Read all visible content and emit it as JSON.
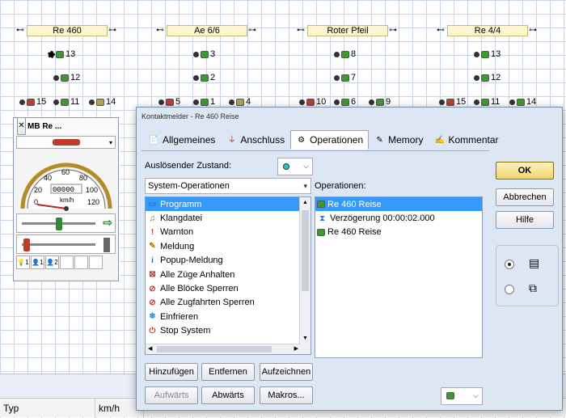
{
  "track": {
    "blocks": [
      {
        "label": "Re 460"
      },
      {
        "label": "Ae 6/6"
      },
      {
        "label": "Roter Pfeil"
      },
      {
        "label": "Re 4/4"
      }
    ],
    "signals": {
      "c1": [
        "13",
        "12",
        "15",
        "11",
        "14"
      ],
      "c2": [
        "3",
        "2",
        "5",
        "1",
        "4"
      ],
      "c3": [
        "8",
        "7",
        "10",
        "6",
        "9"
      ],
      "c4": [
        "13",
        "12",
        "15",
        "11",
        "14"
      ]
    }
  },
  "statusbar": {
    "col1": "Typ",
    "col2": "km/h"
  },
  "loco_panel": {
    "title": "MB Re ...",
    "speed_unit": "km/h",
    "odometer": "00000",
    "gauge_ticks": [
      "0",
      "20",
      "40",
      "60",
      "80",
      "100",
      "120"
    ],
    "speed_value": 0,
    "fn_labels": [
      "1",
      "1",
      "2"
    ]
  },
  "dialog": {
    "title": "Kontaktmelder - Re 460 Reise",
    "tabs": [
      {
        "label": "Allgemeines",
        "icon": "general-icon"
      },
      {
        "label": "Anschluss",
        "icon": "plug-icon"
      },
      {
        "label": "Operationen",
        "icon": "operations-icon"
      },
      {
        "label": "Memory",
        "icon": "memory-icon"
      },
      {
        "label": "Kommentar",
        "icon": "comment-icon"
      }
    ],
    "trigger_label": "Auslösender Zustand:",
    "category_value": "System-Operationen",
    "operations_label": "Operationen:",
    "available_ops": [
      {
        "label": "Programm",
        "icon": "program-icon",
        "color": "#3b6fd1"
      },
      {
        "label": "Klangdatei",
        "icon": "sound-icon",
        "color": "#4a7c2f"
      },
      {
        "label": "Warnton",
        "icon": "warning-icon",
        "color": "#c0392b"
      },
      {
        "label": "Meldung",
        "icon": "message-icon",
        "color": "#b8860b"
      },
      {
        "label": "Popup-Meldung",
        "icon": "info-icon",
        "color": "#2b5fb5"
      },
      {
        "label": "Alle Züge Anhalten",
        "icon": "stop-trains-icon",
        "color": "#c0392b"
      },
      {
        "label": "Alle Blöcke Sperren",
        "icon": "lock-blocks-icon",
        "color": "#c0392b"
      },
      {
        "label": "Alle Zugfahrten Sperren",
        "icon": "lock-routes-icon",
        "color": "#c0392b"
      },
      {
        "label": "Einfrieren",
        "icon": "freeze-icon",
        "color": "#2b8fd1"
      },
      {
        "label": "Stop System",
        "icon": "stop-system-icon",
        "color": "#c0392b"
      }
    ],
    "selected_ops": [
      {
        "label": "Re 460 Reise",
        "icon": "contact-green-icon"
      },
      {
        "label": "Verzögerung 00:00:02.000",
        "icon": "hourglass-icon"
      },
      {
        "label": "Re 460 Reise",
        "icon": "contact-green-icon"
      }
    ],
    "buttons": {
      "add": "Hinzufügen",
      "remove": "Entfernen",
      "record": "Aufzeichnen",
      "up": "Aufwärts",
      "down": "Abwärts",
      "macros": "Makros...",
      "ok": "OK",
      "cancel": "Abbrechen",
      "help": "Hilfe"
    }
  }
}
